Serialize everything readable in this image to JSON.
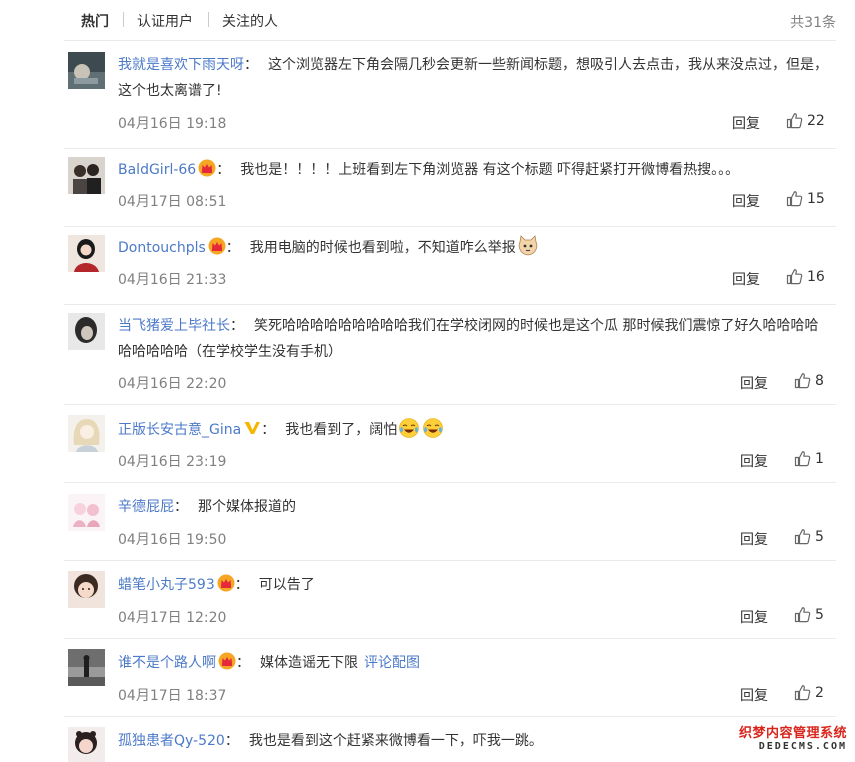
{
  "tabs": [
    {
      "label": "热门",
      "active": true
    },
    {
      "label": "认证用户",
      "active": false
    },
    {
      "label": "关注的人",
      "active": false
    }
  ],
  "total_count": "共31条",
  "reply_label": "回复",
  "comments": [
    {
      "username": "我就是喜欢下雨天呀",
      "badge": "",
      "colon": "：",
      "text": "这个浏览器左下角会隔几秒会更新一些新闻标题，想吸引人去点击，我从来没点过，但是，这个也太离谱了!",
      "date": "04月16日 19:18",
      "likes": "22"
    },
    {
      "username": "BaldGirl-66",
      "badge": "crown-badge",
      "colon": "：",
      "text": "我也是！！！！上班看到左下角浏览器 有这个标题 吓得赶紧打开微博看热搜。。。",
      "date": "04月17日 08:51",
      "likes": "15"
    },
    {
      "username": "Dontouchpls",
      "badge": "crown-badge",
      "colon": "：",
      "text": "我用电脑的时候也看到啦，不知道咋么举报",
      "emoji": "cat-emoji",
      "date": "04月16日 21:33",
      "likes": "16"
    },
    {
      "username": "当飞猪爱上毕社长",
      "badge": "",
      "colon": "：",
      "text": "笑死哈哈哈哈哈哈哈哈哈我们在学校闭网的时候也是这个瓜 那时候我们震惊了好久哈哈哈哈哈哈哈哈哈（在学校学生没有手机）",
      "date": "04月16日 22:20",
      "likes": "8"
    },
    {
      "username": "正版长安古意_Gina",
      "badge": "v-badge",
      "colon": "：",
      "text": "我也看到了，阔怕",
      "emoji": "crying-laughing-emoji",
      "date": "04月16日 23:19",
      "likes": "1"
    },
    {
      "username": "辛德屁屁",
      "badge": "",
      "colon": "：",
      "text": "那个媒体报道的",
      "date": "04月16日 19:50",
      "likes": "5"
    },
    {
      "username": "蜡笔小丸子593",
      "badge": "crown-badge",
      "colon": "：",
      "text": "可以告了",
      "date": "04月17日 12:20",
      "likes": "5"
    },
    {
      "username": "谁不是个路人啊",
      "badge": "crown-badge",
      "colon": "：",
      "text": "媒体造谣无下限",
      "link": "评论配图",
      "date": "04月17日 18:37",
      "likes": "2"
    },
    {
      "username": "孤独患者Qy-520",
      "badge": "",
      "colon": "：",
      "text": "我也是看到这个赶紧来微博看一下，吓我一跳。",
      "date": "",
      "likes": ""
    }
  ],
  "watermark": {
    "line1": "织梦内容管理系统",
    "line2": "DEDECMS.COM"
  },
  "colors": {
    "username": "#4c7ac8",
    "meta": "#808080",
    "divider": "#eaeaea",
    "crown": "#f6a623",
    "v_badge": "#f6b600"
  }
}
